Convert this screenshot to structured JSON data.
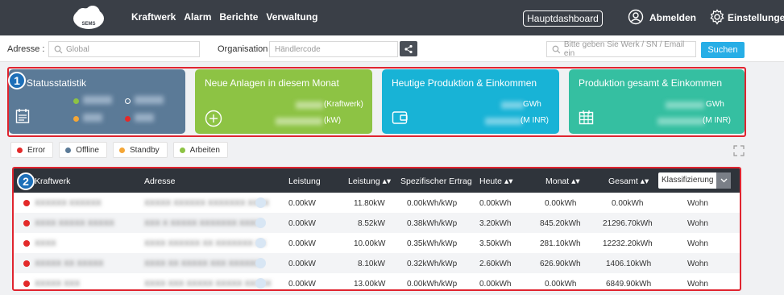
{
  "header": {
    "logo_text": "SEMS",
    "nav": [
      "Kraftwerk",
      "Alarm",
      "Berichte",
      "Verwaltung"
    ],
    "hauptdashboard": "Hauptdashboard",
    "abmelden": "Abmelden",
    "einstellungen": "Einstellungen"
  },
  "filters": {
    "adresse_label": "Adresse :",
    "adresse_value": "Global",
    "organisation_label": "Organisation :",
    "organisation_placeholder": "Händlercode",
    "search_placeholder": "Bitte geben Sie Werk / SN / Email ein",
    "search_button": "Suchen"
  },
  "cards": [
    {
      "title": "Statusstatistik",
      "badge": "1"
    },
    {
      "title": "Neue Anlagen in diesem Monat",
      "unit1": "(Kraftwerk)",
      "unit2": "(kW)"
    },
    {
      "title": "Heutige Produktion & Einkommen",
      "unit1": "GWh",
      "unit2": "(M INR)"
    },
    {
      "title": "Produktion gesamt & Einkommen",
      "unit1": "GWh",
      "unit2": "(M INR)"
    }
  ],
  "legend": [
    {
      "label": "Error",
      "color": "#e32a2a"
    },
    {
      "label": "Offline",
      "color": "#5b7a97"
    },
    {
      "label": "Standby",
      "color": "#f4a637"
    },
    {
      "label": "Arbeiten",
      "color": "#8dc344"
    }
  ],
  "table": {
    "badge": "2",
    "headers": {
      "kraftwerk": "Kraftwerk",
      "adresse": "Adresse",
      "leistung": "Leistung",
      "leistung_sort": "Leistung",
      "ertrag": "Spezifischer Ertrag",
      "heute": "Heute",
      "monat": "Monat",
      "gesamt": "Gesamt",
      "klass": "Klassifizierung"
    },
    "rows": [
      {
        "leistung": "0.00kW",
        "leistung2": "11.80kW",
        "ertrag": "0.00kWh/kWp",
        "heute": "0.00kWh",
        "monat": "0.00kWh",
        "gesamt": "0.00kWh",
        "typ": "Wohn"
      },
      {
        "leistung": "0.00kW",
        "leistung2": "8.52kW",
        "ertrag": "0.38kWh/kWp",
        "heute": "3.20kWh",
        "monat": "845.20kWh",
        "gesamt": "21296.70kWh",
        "typ": "Wohn"
      },
      {
        "leistung": "0.00kW",
        "leistung2": "10.00kW",
        "ertrag": "0.35kWh/kWp",
        "heute": "3.50kWh",
        "monat": "281.10kWh",
        "gesamt": "12232.20kWh",
        "typ": "Wohn"
      },
      {
        "leistung": "0.00kW",
        "leistung2": "8.10kW",
        "ertrag": "0.32kWh/kWp",
        "heute": "2.60kWh",
        "monat": "626.90kWh",
        "gesamt": "1406.10kWh",
        "typ": "Wohn"
      },
      {
        "leistung": "0.00kW",
        "leistung2": "13.00kW",
        "ertrag": "0.00kWh/kWp",
        "heute": "0.00kWh",
        "monat": "0.00kWh",
        "gesamt": "6849.90kWh",
        "typ": "Wohn"
      }
    ]
  }
}
